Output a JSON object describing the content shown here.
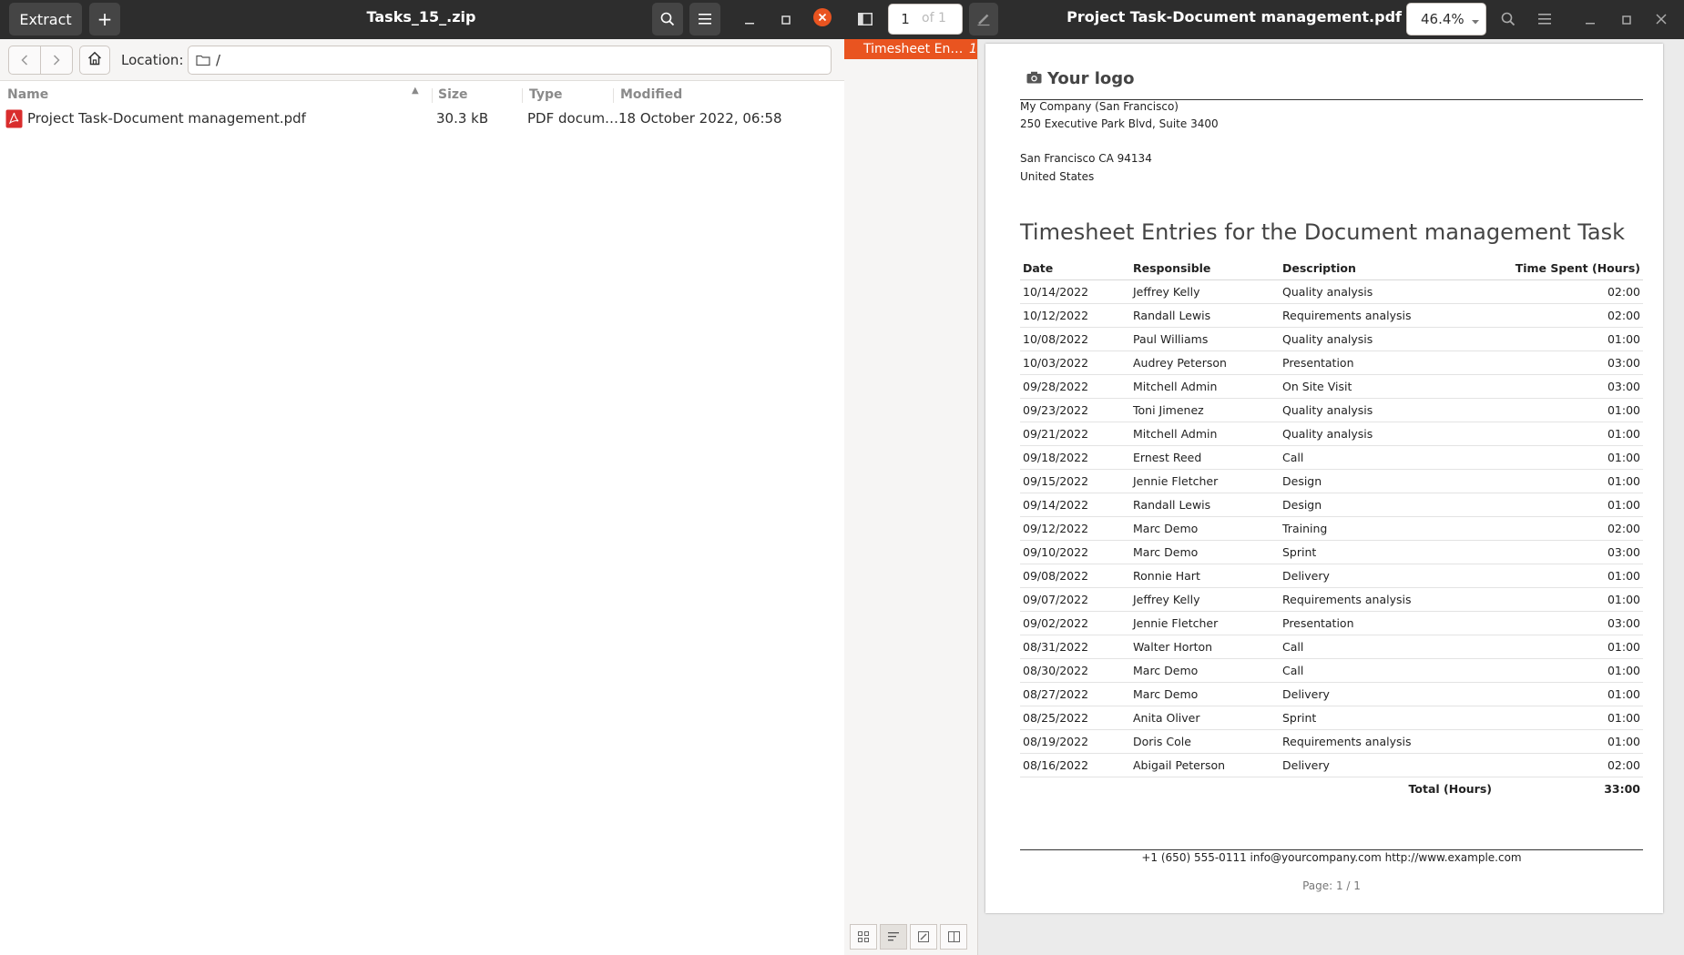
{
  "archive_window": {
    "title": "Tasks_15_.zip",
    "extract_label": "Extract",
    "add_label": "+",
    "location_label": "Location:",
    "location_path": "/",
    "columns": {
      "name": "Name",
      "size": "Size",
      "type": "Type",
      "modified": "Modified"
    },
    "files": [
      {
        "name": "Project Task-Document management.pdf",
        "size": "30.3 kB",
        "type": "PDF docum…",
        "modified": "18 October 2022, 06:58"
      }
    ]
  },
  "viewer_window": {
    "title": "Project Task-Document management.pdf",
    "page_current": "1",
    "page_of": "of 1",
    "zoom": "46.4%",
    "outline": {
      "label": "Timesheet En…",
      "page": "1"
    }
  },
  "document": {
    "logo_text": "Your logo",
    "company_lines": [
      "My Company (San Francisco)",
      "250 Executive Park Blvd, Suite 3400",
      "San Francisco CA 94134",
      "United States"
    ],
    "heading": "Timesheet Entries for the Document management Task",
    "table": {
      "headers": [
        "Date",
        "Responsible",
        "Description",
        "Time Spent (Hours)"
      ],
      "rows": [
        [
          "10/14/2022",
          "Jeffrey Kelly",
          "Quality analysis",
          "02:00"
        ],
        [
          "10/12/2022",
          "Randall Lewis",
          "Requirements analysis",
          "02:00"
        ],
        [
          "10/08/2022",
          "Paul Williams",
          "Quality analysis",
          "01:00"
        ],
        [
          "10/03/2022",
          "Audrey Peterson",
          "Presentation",
          "03:00"
        ],
        [
          "09/28/2022",
          "Mitchell Admin",
          "On Site Visit",
          "03:00"
        ],
        [
          "09/23/2022",
          "Toni Jimenez",
          "Quality analysis",
          "01:00"
        ],
        [
          "09/21/2022",
          "Mitchell Admin",
          "Quality analysis",
          "01:00"
        ],
        [
          "09/18/2022",
          "Ernest Reed",
          "Call",
          "01:00"
        ],
        [
          "09/15/2022",
          "Jennie Fletcher",
          "Design",
          "01:00"
        ],
        [
          "09/14/2022",
          "Randall Lewis",
          "Design",
          "01:00"
        ],
        [
          "09/12/2022",
          "Marc Demo",
          "Training",
          "02:00"
        ],
        [
          "09/10/2022",
          "Marc Demo",
          "Sprint",
          "03:00"
        ],
        [
          "09/08/2022",
          "Ronnie Hart",
          "Delivery",
          "01:00"
        ],
        [
          "09/07/2022",
          "Jeffrey Kelly",
          "Requirements analysis",
          "01:00"
        ],
        [
          "09/02/2022",
          "Jennie Fletcher",
          "Presentation",
          "03:00"
        ],
        [
          "08/31/2022",
          "Walter Horton",
          "Call",
          "01:00"
        ],
        [
          "08/30/2022",
          "Marc Demo",
          "Call",
          "01:00"
        ],
        [
          "08/27/2022",
          "Marc Demo",
          "Delivery",
          "01:00"
        ],
        [
          "08/25/2022",
          "Anita Oliver",
          "Sprint",
          "01:00"
        ],
        [
          "08/19/2022",
          "Doris Cole",
          "Requirements analysis",
          "01:00"
        ],
        [
          "08/16/2022",
          "Abigail Peterson",
          "Delivery",
          "02:00"
        ]
      ],
      "total_label": "Total (Hours)",
      "total_value": "33:00"
    },
    "footer_contact": "+1 (650) 555-0111 info@yourcompany.com http://www.example.com",
    "footer_page": "Page: 1 / 1"
  },
  "colors": {
    "accent": "#e95420",
    "headerbar": "#2d2d2d",
    "close_button": "#e95420"
  }
}
